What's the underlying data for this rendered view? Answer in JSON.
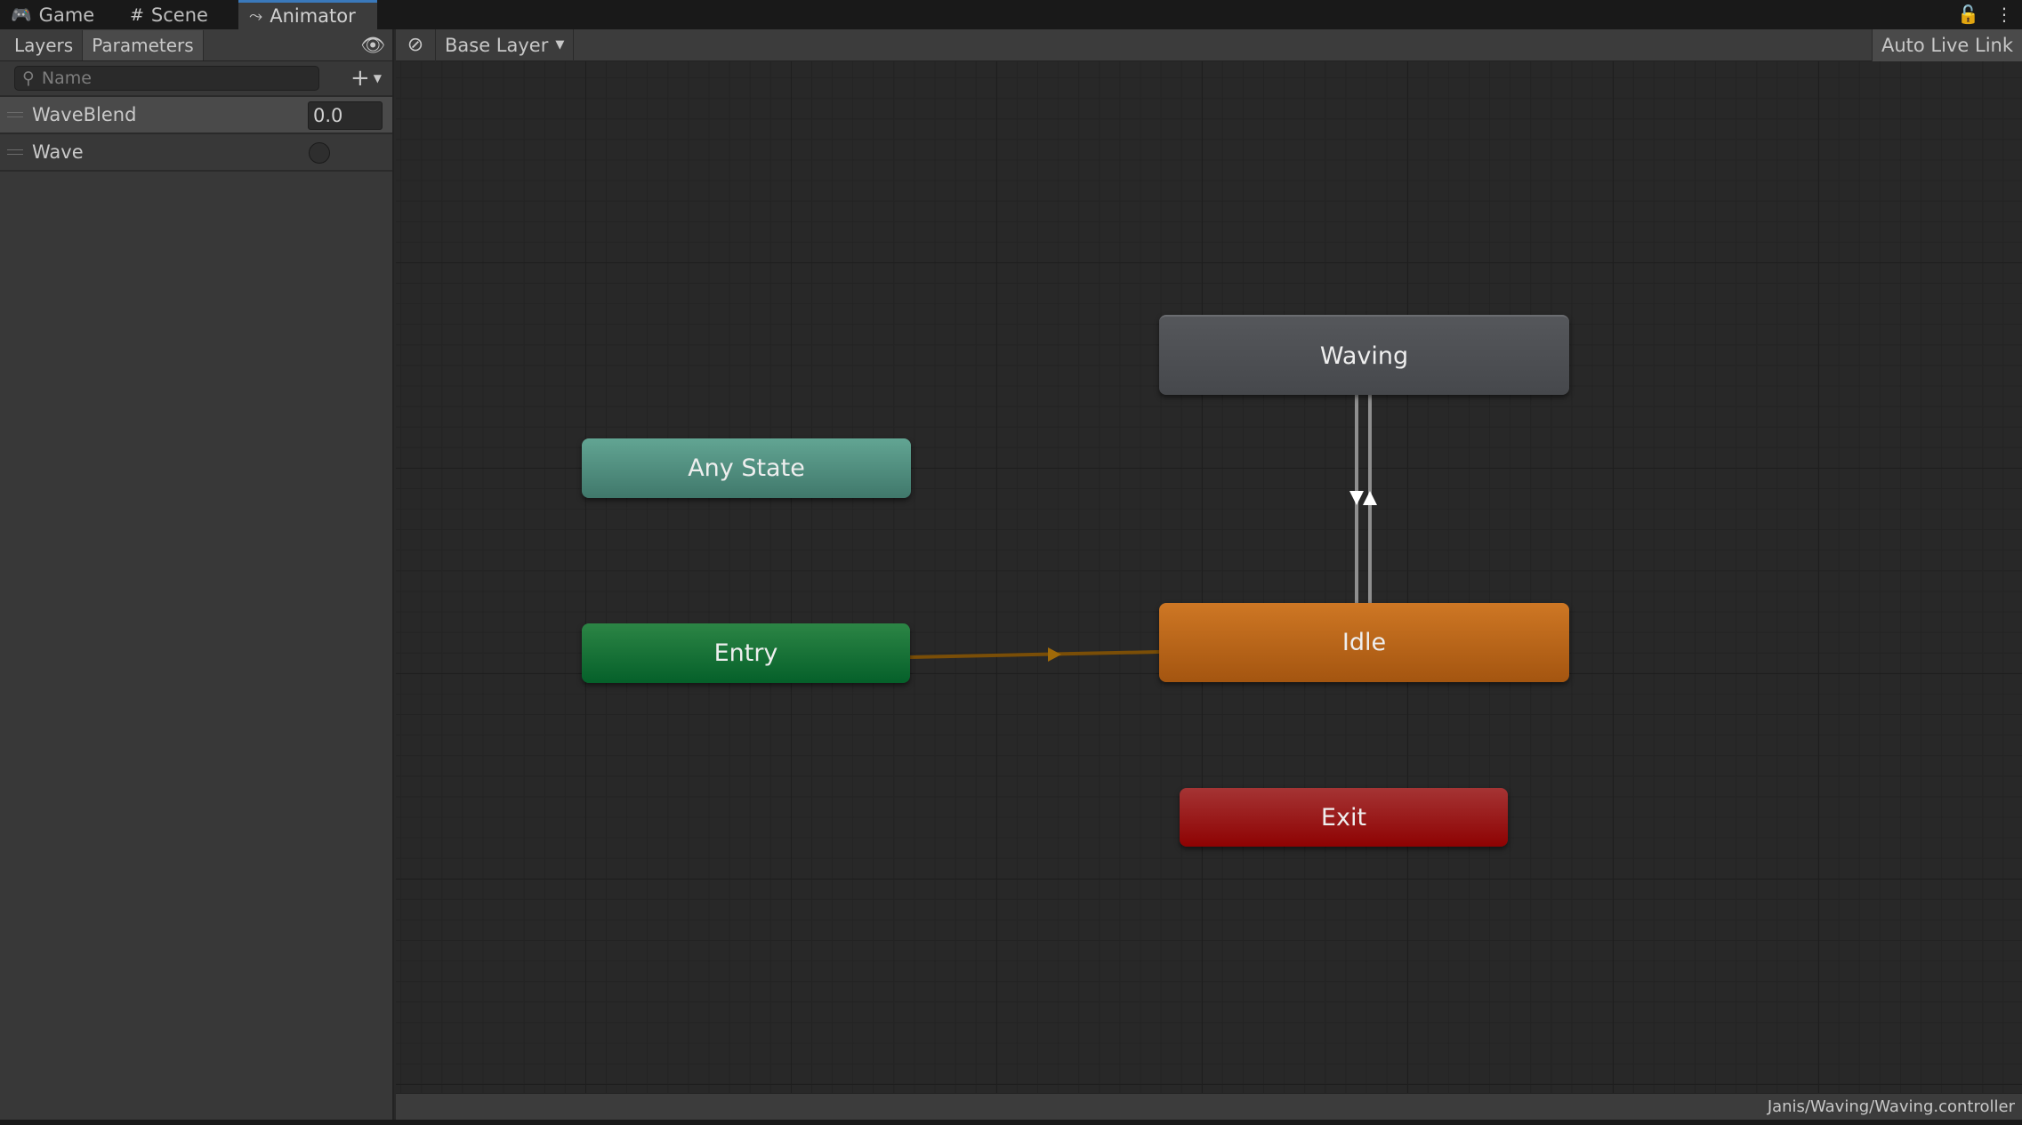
{
  "tabs": [
    {
      "label": "Game",
      "icon": "gamepad-icon",
      "glyph": "🎮"
    },
    {
      "label": "Scene",
      "icon": "grid-icon",
      "glyph": "#"
    },
    {
      "label": "Animator",
      "icon": "animator-icon",
      "glyph": "⤳"
    }
  ],
  "active_tab": "Animator",
  "tab_actions": {
    "lock_glyph": "🔓",
    "menu_glyph": "⋮"
  },
  "sidebar": {
    "subtabs": [
      "Layers",
      "Parameters"
    ],
    "active_subtab": "Parameters",
    "search_placeholder": "Name",
    "add_glyph": "+",
    "parameters": [
      {
        "name": "WaveBlend",
        "type": "float",
        "value": "0.0"
      },
      {
        "name": "Wave",
        "type": "bool",
        "value": false
      }
    ]
  },
  "toolbar": {
    "layer": "Base Layer",
    "auto_live_link": "Auto Live Link"
  },
  "graph": {
    "states": [
      {
        "id": "waving",
        "label": "Waving",
        "kind": "state",
        "color": "#4b4d51"
      },
      {
        "id": "any",
        "label": "Any State",
        "kind": "any",
        "color": "#4f9487"
      },
      {
        "id": "entry",
        "label": "Entry",
        "kind": "entry",
        "color": "#12722e"
      },
      {
        "id": "idle",
        "label": "Idle",
        "kind": "default",
        "color": "#c6701f"
      },
      {
        "id": "exit",
        "label": "Exit",
        "kind": "exit",
        "color": "#a01515"
      }
    ],
    "transitions": [
      {
        "from": "entry",
        "to": "idle",
        "color": "#7a4e07"
      },
      {
        "from": "waving",
        "to": "idle",
        "color": "#9a9a9a"
      },
      {
        "from": "idle",
        "to": "waving",
        "color": "#9a9a9a"
      }
    ]
  },
  "statusbar": {
    "path": "Janis/Waving/Waving.controller"
  }
}
